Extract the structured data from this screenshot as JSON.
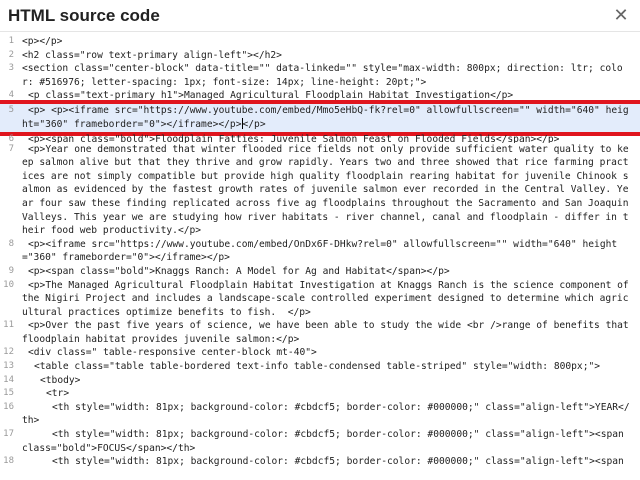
{
  "dialog": {
    "title": "HTML source code",
    "close_symbol": "✕"
  },
  "editor": {
    "lines": [
      {
        "n": "1",
        "text": "<p></p>"
      },
      {
        "n": "2",
        "text": "<h2 class=\"row text-primary align-left\"></h2>"
      },
      {
        "n": "3",
        "text": "<section class=\"center-block\" data-title=\"\" data-linked=\"\" style=\"max-width: 800px; direction: ltr; color: #516976; letter-spacing: 1px; font-size: 14px; line-height: 20pt;\">"
      },
      {
        "n": "4",
        "text": "<p class=\"text-primary h1\">Managed Agricultural Floodplain Habitat Investigation</p>"
      },
      {
        "n": "5",
        "text": "<p> <p><iframe src=\"https://www.youtube.com/embed/Mmo5eHbQ-fk?rel=0\" allowfullscreen=\"\" width=\"640\" height=\"360\" frameborder=\"0\"></iframe></p>",
        "after_cursor": "</p>"
      },
      {
        "n": "6",
        "text": "<p><span class=\"bold\">Floodplain Fatties: Juvenile Salmon Feast on Flooded Fields</span></p>"
      },
      {
        "n": "7",
        "text": "<p>Year one demonstrated that winter flooded rice fields not only provide sufficient water quality to keep salmon alive but that they thrive and grow rapidly. Years two and three showed that rice farming practices are not simply compatible but provide high quality floodplain rearing habitat for juvenile Chinook salmon as evidenced by the fastest growth rates of juvenile salmon ever recorded in the Central Valley. Year four saw these finding replicated across five ag floodplains throughout the Sacramento and San Joaquin Valleys. This year we are studying how river habitats - river channel, canal and floodplain - differ in their food web productivity.</p>"
      },
      {
        "n": "8",
        "text": "<p><iframe src=\"https://www.youtube.com/embed/OnDx6F-DHkw?rel=0\" allowfullscreen=\"\" width=\"640\" height=\"360\" frameborder=\"0\"></iframe></p>"
      },
      {
        "n": "9",
        "text": "<p><span class=\"bold\">Knaggs Ranch: A Model for Ag and Habitat</span></p>"
      },
      {
        "n": "10",
        "text": "<p>The Managed Agricultural Floodplain Habitat Investigation at Knaggs Ranch is the science component of the Nigiri Project and includes a landscape-scale controlled experiment designed to determine which agricultural practices optimize benefits to fish.  </p>"
      },
      {
        "n": "11",
        "text": "<p>Over the past five years of science, we have been able to study the wide <br />range of benefits that floodplain habitat provides juvenile salmon:</p>"
      },
      {
        "n": "12",
        "text": "<div class=\" table-responsive center-block mt-40\">"
      },
      {
        "n": "13",
        "text": "<table class=\"table table-bordered text-info table-condensed table-striped\" style=\"width: 800px;\">"
      },
      {
        "n": "14",
        "text": "<tbody>"
      },
      {
        "n": "15",
        "text": "<tr>"
      },
      {
        "n": "16",
        "text": "<th style=\"width: 81px; background-color: #cbdcf5; border-color: #000000;\" class=\"align-left\">YEAR</th>"
      },
      {
        "n": "17",
        "text": "<th style=\"width: 81px; background-color: #cbdcf5; border-color: #000000;\" class=\"align-left\"><span class=\"bold\">FOCUS</span></th>"
      },
      {
        "n": "18",
        "text": "<th style=\"width: 81px; background-color: #cbdcf5; border-color: #000000;\" class=\"align-left\"><span"
      }
    ]
  }
}
